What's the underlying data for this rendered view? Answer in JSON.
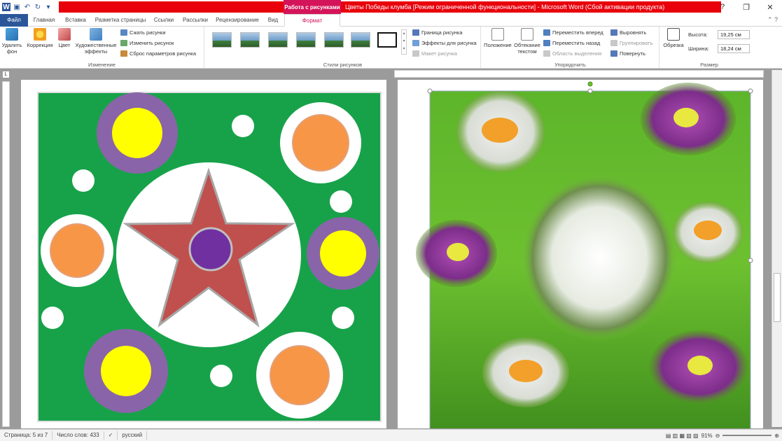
{
  "titlebar": {
    "picture_tools": "Работа с рисунками",
    "document_title": "Цветы Победы клумба [Режим ограниченной функциональности] - Microsoft Word (Сбой активации продукта)"
  },
  "tabs": [
    {
      "label": "Файл"
    },
    {
      "label": "Главная"
    },
    {
      "label": "Вставка"
    },
    {
      "label": "Разметка страницы"
    },
    {
      "label": "Ссылки"
    },
    {
      "label": "Рассылки"
    },
    {
      "label": "Рецензирование"
    },
    {
      "label": "Вид"
    },
    {
      "label": "Формат"
    }
  ],
  "ribbon": {
    "change": {
      "remove_bg": "Удалить фон",
      "correction": "Коррекция",
      "color": "Цвет",
      "artistic": "Художественные эффекты",
      "compress": "Сжать рисунки",
      "change_pic": "Изменить рисунок",
      "reset_params": "Сброс параметров рисунка",
      "label": "Изменение"
    },
    "styles": {
      "label": "Стили рисунков",
      "border": "Граница рисунка",
      "effects": "Эффекты для рисунка",
      "layout": "Макет рисунка"
    },
    "arrange": {
      "position": "Положение",
      "wrap": "Обтекание текстом",
      "bring_forward": "Переместить вперед",
      "send_backward": "Переместить назад",
      "selection_pane": "Область выделения",
      "align": "Выровнять",
      "group": "Группировать",
      "rotate": "Повернуть",
      "label": "Упорядочить"
    },
    "size": {
      "crop": "Обрезка",
      "height_label": "Высота:",
      "height_value": "19,25 см",
      "width_label": "Ширина:",
      "width_value": "18,24 см",
      "label": "Размер"
    }
  },
  "status": {
    "page": "Страница: 5 из 7",
    "words": "Число слов: 433",
    "language": "русский",
    "zoom": "91%"
  },
  "colors": {
    "accent": "#2b579a",
    "picture_tools": "#d4145a",
    "title_red": "#e8000b",
    "lawn": "#17a24a",
    "purple": "#8a64a8",
    "yellow": "#ffff00",
    "orange": "#f79646",
    "star": "#c0504d",
    "star_center": "#7030a0"
  }
}
